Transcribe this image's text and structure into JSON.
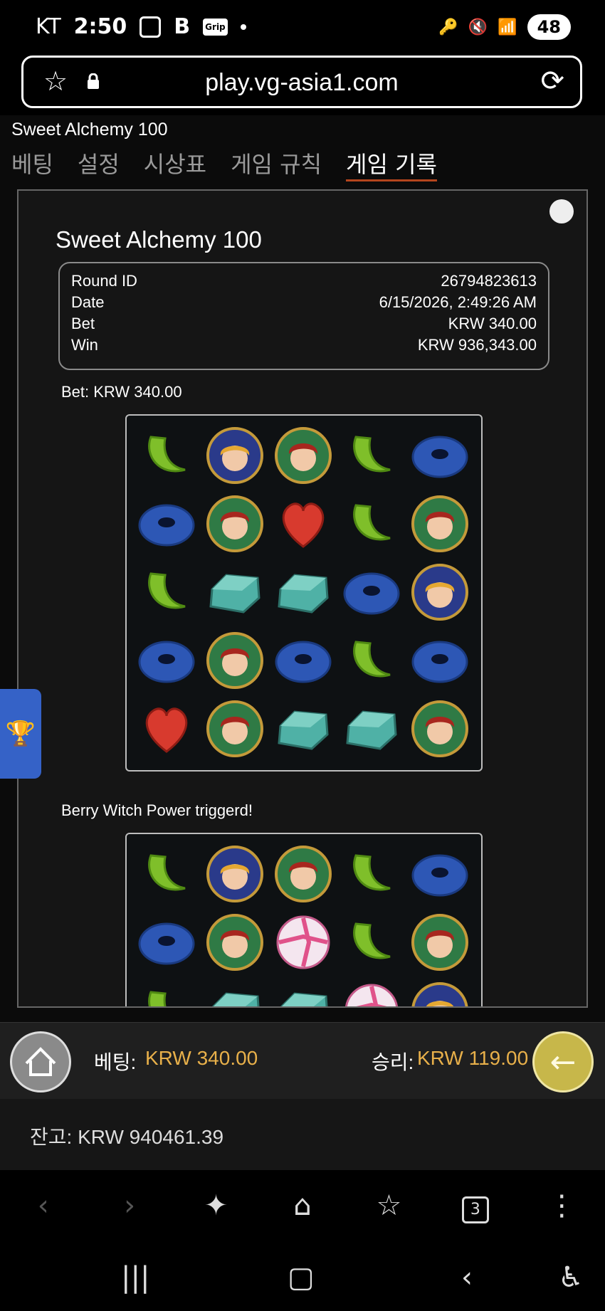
{
  "status_bar": {
    "carrier": "KT",
    "time": "2:50",
    "battery": "48"
  },
  "url_bar": {
    "url": "play.vg-asia1.com"
  },
  "game": {
    "title": "Sweet Alchemy 100",
    "tabs": [
      "베팅",
      "설정",
      "시상표",
      "게임 규칙",
      "게임 기록"
    ],
    "active_tab": "게임 기록"
  },
  "history": {
    "title": "Sweet Alchemy 100",
    "info": [
      {
        "label": "Round ID",
        "value": "26794823613"
      },
      {
        "label": "Date",
        "value": "6/15/2026, 2:49:26 AM"
      },
      {
        "label": "Bet",
        "value": "KRW 340.00"
      },
      {
        "label": "Win",
        "value": "KRW 936,343.00"
      }
    ],
    "bet_line": "Bet: KRW 340.00",
    "trigger_line": "Berry Witch Power triggerd!",
    "grid1": [
      [
        "green-bean",
        "blonde-witch",
        "red-witch",
        "green-bean",
        "blue-donut"
      ],
      [
        "blue-donut",
        "red-witch",
        "red-heart",
        "green-bean",
        "red-witch"
      ],
      [
        "green-bean",
        "teal-gem",
        "teal-gem",
        "blue-donut",
        "blonde-witch"
      ],
      [
        "blue-donut",
        "red-witch",
        "blue-donut",
        "green-bean",
        "blue-donut"
      ],
      [
        "red-heart",
        "red-witch",
        "teal-gem",
        "teal-gem",
        "red-witch"
      ]
    ],
    "grid2": [
      [
        "green-bean",
        "blonde-witch",
        "red-witch",
        "green-bean",
        "blue-donut"
      ],
      [
        "blue-donut",
        "red-witch",
        "swirl-candy",
        "green-bean",
        "red-witch"
      ],
      [
        "green-bean",
        "teal-gem",
        "teal-gem",
        "swirl-candy",
        "blonde-witch"
      ]
    ]
  },
  "game_bar": {
    "bet_label": "베팅:",
    "bet_value": "KRW 340.00",
    "win_label": "승리:",
    "win_value": "KRW 119.00",
    "balance": "잔고: KRW 940461.39"
  },
  "browser_toolbar": {
    "tabs_count": "3"
  }
}
